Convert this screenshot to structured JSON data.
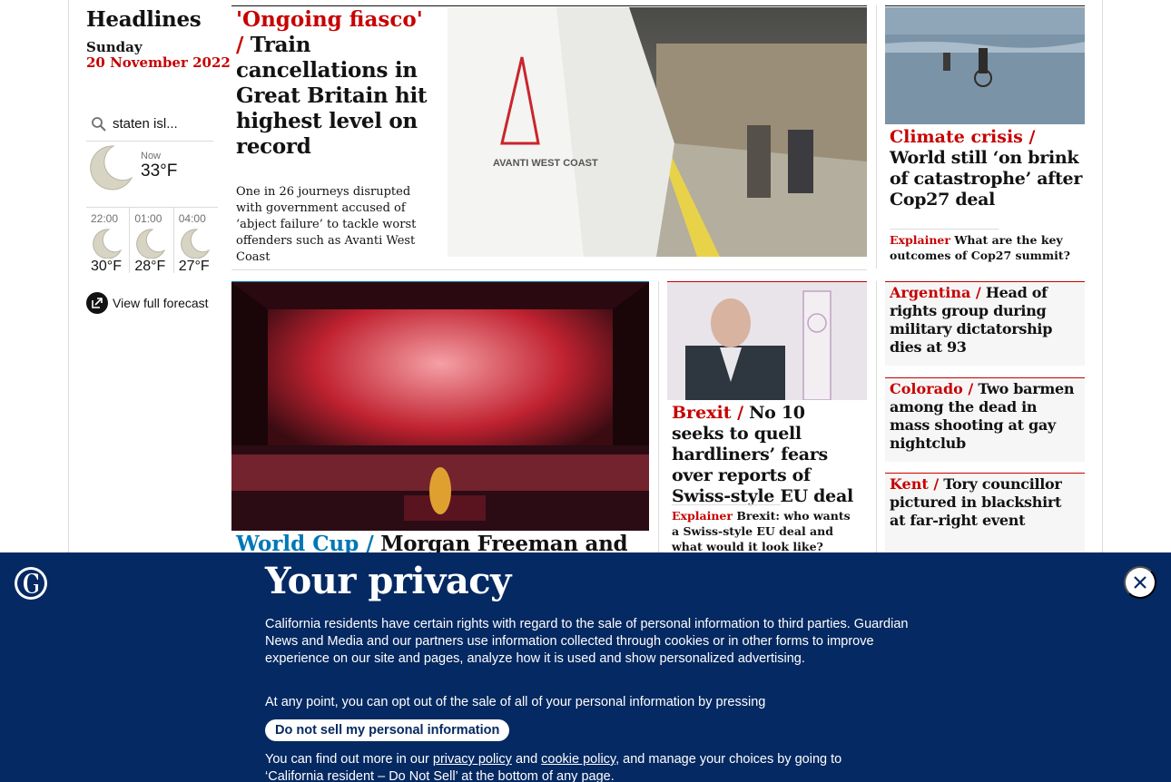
{
  "headlines": {
    "title": "Headlines",
    "day": "Sunday",
    "date": "20 November 2022"
  },
  "weather": {
    "search_value": "staten isl...",
    "now_label": "Now",
    "now_temp": "33°F",
    "hours": [
      {
        "time": "22:00",
        "temp": "30°F"
      },
      {
        "time": "01:00",
        "temp": "28°F"
      },
      {
        "time": "04:00",
        "temp": "27°F"
      }
    ],
    "full_forecast_label": "View full forecast",
    "icon": "moon-icon"
  },
  "main_story": {
    "kicker": "'Ongoing fiasco' /",
    "headline": "Train cancellations in Great Britain hit highest level on record",
    "standfirst": "One in 26 journeys disrupted with government accused of ‘abject failure’ to tackle worst offenders such as Avanti West Coast",
    "photo_text": "AVANTI WEST COAST"
  },
  "climate_story": {
    "kicker": "Climate crisis /",
    "headline": "World still ‘on brink of catastrophe’ after Cop27 deal",
    "sub_kicker": "Explainer",
    "sub_headline": "What are the key outcomes of Cop27 summit?"
  },
  "worldcup_story": {
    "kicker": "World Cup /",
    "headline": "Morgan Freeman and"
  },
  "brexit_story": {
    "kicker": "Brexit /",
    "headline": "No 10 seeks to quell hardliners’ fears over reports of Swiss-style EU deal",
    "sub_kicker": "Explainer",
    "sub_headline": "Brexit: who wants a Swiss-style EU deal and what would it look like?"
  },
  "side_stories": [
    {
      "kicker": "Argentina /",
      "headline": "Head of rights group during military dictatorship dies at 93"
    },
    {
      "kicker": "Colorado /",
      "headline": "Two barmen among the dead in mass shooting at gay nightclub"
    },
    {
      "kicker": "Kent /",
      "headline": "Tory councillor pictured in blackshirt at far-right event"
    }
  ],
  "privacy": {
    "title": "Your privacy",
    "para1": "California residents have certain rights with regard to the sale of personal information to third parties. Guardian News and Media and our partners use information collected through cookies or in other forms to improve experience on our site and pages, analyze how it is used and show personalized advertising.",
    "para2": "At any point, you can opt out of the sale of all of your personal information by pressing",
    "button": "Do not sell my personal information",
    "para3_pre": "You can find out more in our",
    "privacy_link": "privacy policy",
    "and": "and",
    "cookie_link": "cookie policy",
    "para3_post": ", and manage your choices by going to ‘California resident – Do Not Sell’ at the bottom of any page."
  },
  "colors": {
    "news_red": "#c70000",
    "sport_blue": "#0077b6",
    "banner_navy": "#052962"
  }
}
